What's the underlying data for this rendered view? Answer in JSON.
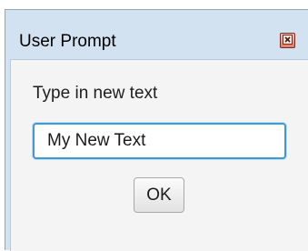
{
  "window": {
    "title": "User Prompt",
    "close_icon": "close-icon"
  },
  "dialog": {
    "prompt_label": "Type in new text",
    "input_value": "My New Text",
    "ok_label": "OK"
  },
  "colors": {
    "title_bar": "#d3e2f1",
    "client_background": "#f4f4f4",
    "input_focus_border": "#3c9ad6",
    "close_button": "#d9816a"
  }
}
